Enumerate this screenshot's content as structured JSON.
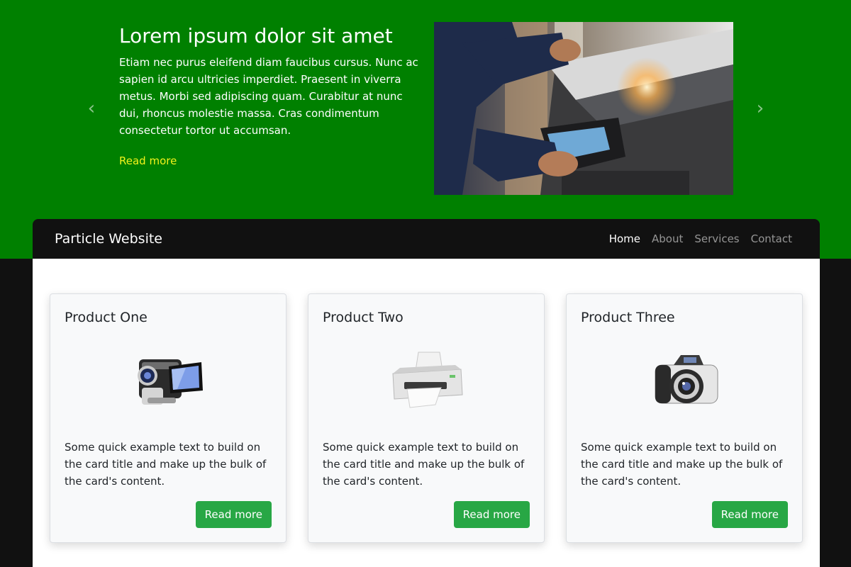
{
  "carousel": {
    "title": "Lorem ipsum dolor sit amet",
    "body": "Etiam nec purus eleifend diam faucibus cursus. Nunc ac sapien id arcu ultricies imperdiet. Praesent in viverra metus. Morbi sed adipiscing quam. Curabitur at nunc dui, rhoncus molestie massa. Cras condimentum consectetur tortor ut accumsan.",
    "link": "Read more",
    "prev_icon": "‹",
    "next_icon": "›"
  },
  "navbar": {
    "brand": "Particle Website",
    "links": [
      "Home",
      "About",
      "Services",
      "Contact"
    ]
  },
  "cards": [
    {
      "title": "Product One",
      "text": "Some quick example text to build on the card title and make up the bulk of the card's content.",
      "button": "Read more"
    },
    {
      "title": "Product Two",
      "text": "Some quick example text to build on the card title and make up the bulk of the card's content.",
      "button": "Read more"
    },
    {
      "title": "Product Three",
      "text": "Some quick example text to build on the card title and make up the bulk of the card's content.",
      "button": "Read more"
    }
  ],
  "colors": {
    "hero_bg": "#008000",
    "nav_bg": "#111111",
    "link_yellow": "#f2f21b",
    "button_green": "#28a745"
  }
}
